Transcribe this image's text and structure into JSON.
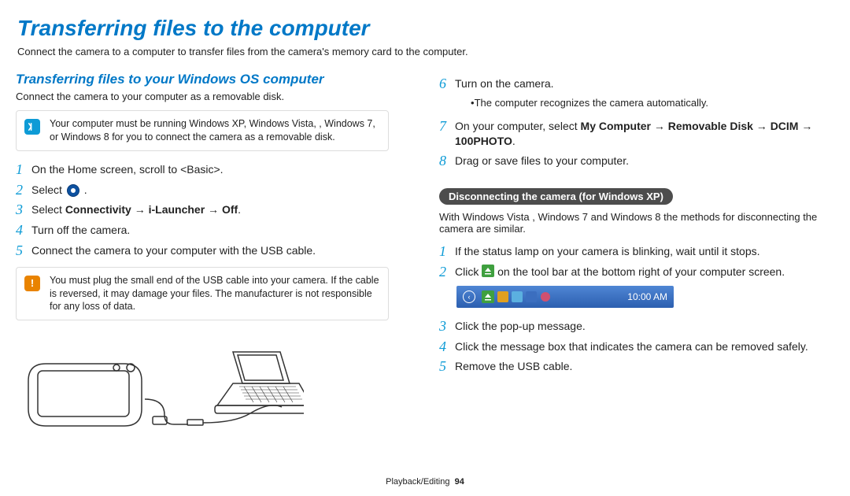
{
  "page_title": "Transferring files to the computer",
  "intro": "Connect the camera to a computer to transfer files from the camera's memory card to the computer.",
  "left": {
    "section_title": "Transferring files to your Windows OS computer",
    "section_sub": "Connect the camera to your computer as a removable disk.",
    "info_box": "Your computer must be running Windows XP, Windows Vista, , Windows 7, or Windows 8 for you to connect the camera as a removable disk.",
    "step1": "On the Home screen, scroll to <Basic>.",
    "step2_before": "Select ",
    "step2_after": " .",
    "step3_before": "Select ",
    "step3_bold": "Connectivity → i-Launcher → Off",
    "step3_after": ".",
    "step4": "Turn off the camera.",
    "step5": "Connect the camera to your computer with the USB cable.",
    "warn_box": "You must plug the small end of the USB cable into your camera. If the cable is reversed, it may damage your files. The manufacturer is not responsible for any loss of data."
  },
  "right": {
    "step6": "Turn on the camera.",
    "step6_sub": "The computer recognizes the camera automatically.",
    "step7_before": "On your computer, select ",
    "step7_bold": "My Computer → Removable Disk → DCIM → 100PHOTO",
    "step7_after": ".",
    "step8": "Drag or save files to your computer.",
    "pill": "Disconnecting the camera (for Windows XP)",
    "pill_sub": "With Windows Vista , Windows 7 and Windows 8 the methods for disconnecting the camera are similar.",
    "d1": "If the status lamp on your camera is blinking, wait until it stops.",
    "d2_before": "Click ",
    "d2_after": " on the tool bar at the bottom right of your computer screen.",
    "tray_time": "10:00 AM",
    "d3": "Click the pop-up message.",
    "d4": "Click the message box that indicates the camera can be removed safely.",
    "d5": "Remove the USB cable."
  },
  "footer_section": "Playback/Editing",
  "footer_page": "94"
}
